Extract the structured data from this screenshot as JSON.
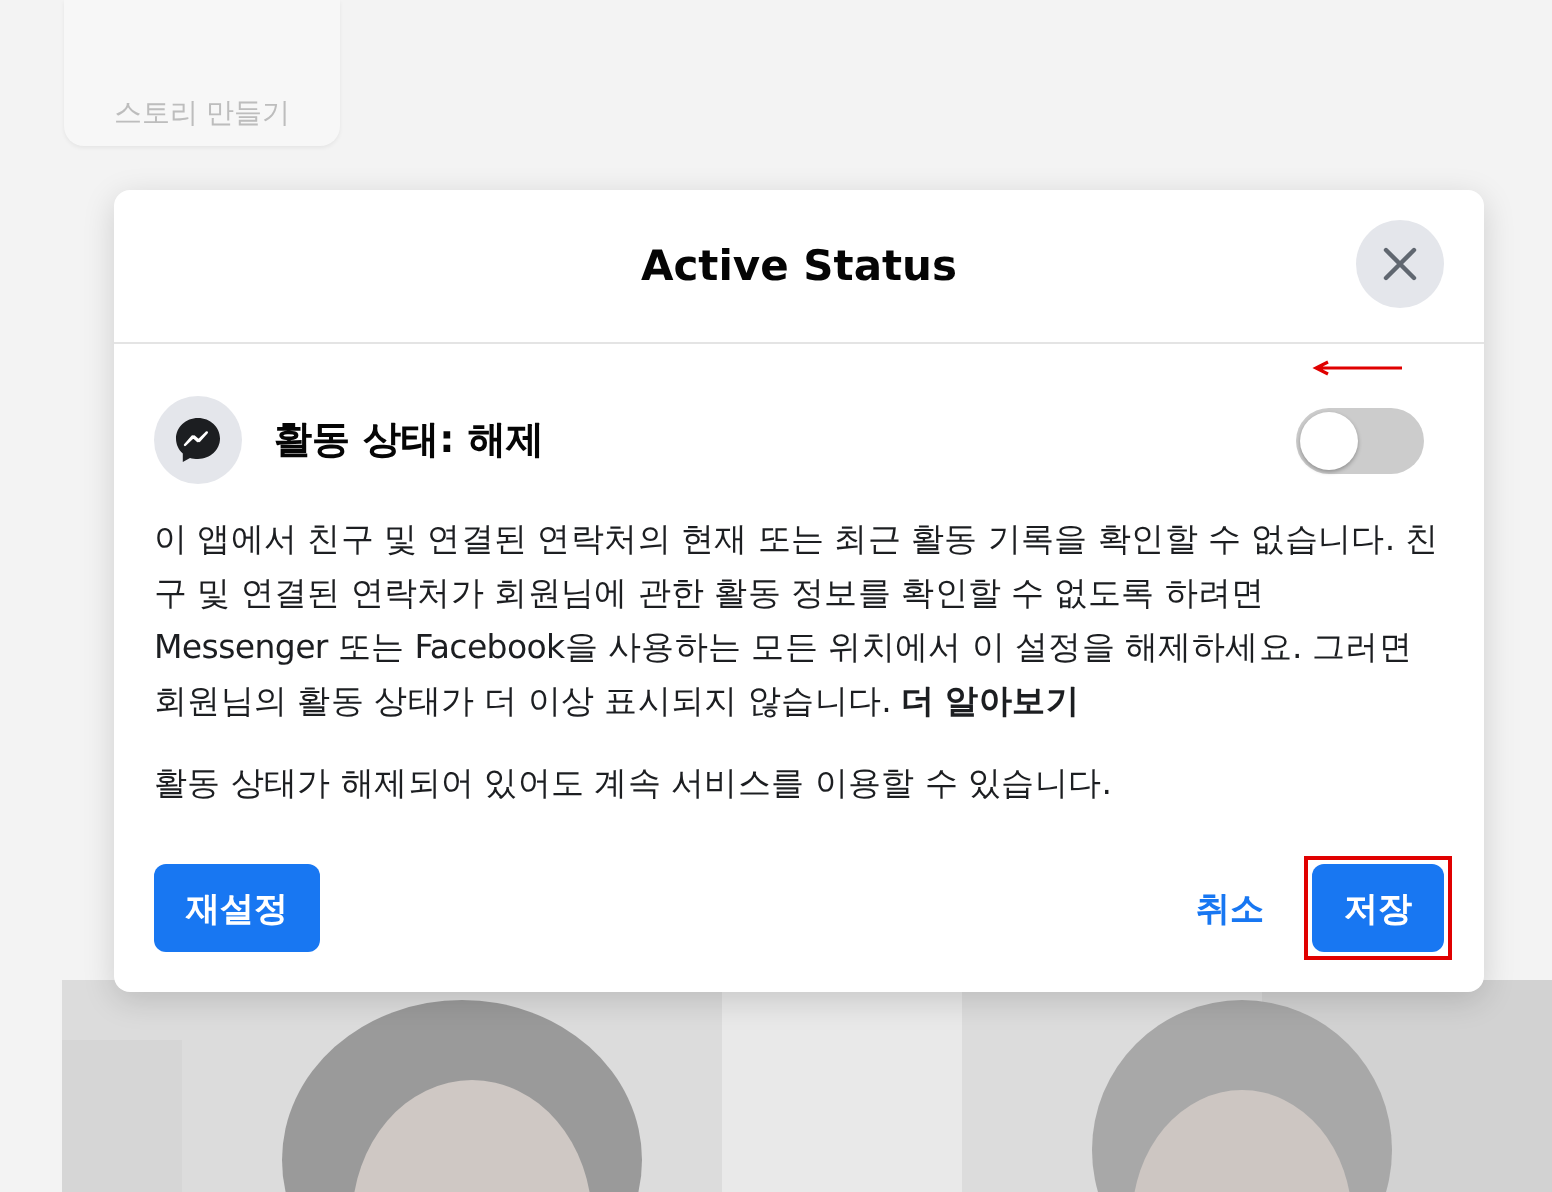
{
  "background": {
    "story_card": {
      "label": "스토리 만들기"
    }
  },
  "dialog": {
    "title": "Active Status",
    "setting": {
      "label": "활동 상태: 해제",
      "on": false
    },
    "paragraphs": [
      "이 앱에서 친구 및 연결된 연락처의 현재 또는 최근 활동 기록을 확인할 수 없습니다. 친구 및 연결된 연락처가 회원님에 관한 활동 정보를 확인할 수 없도록 하려면 Messenger 또는 Facebook을 사용하는 모든 위치에서 이 설정을 해제하세요. 그러면 회원님의 활동 상태가 더 이상 표시되지 않습니다. **더 알아보기**",
      "활동 상태가 해제되어 있어도 계속 서비스를 이용할 수 있습니다."
    ],
    "buttons": [
      {
        "kind": "primary",
        "label": "재설정",
        "highlighted": false
      },
      {
        "kind": "text",
        "label": "취소",
        "highlighted": false
      },
      {
        "kind": "primary",
        "label": "저장",
        "highlighted": true
      }
    ]
  }
}
